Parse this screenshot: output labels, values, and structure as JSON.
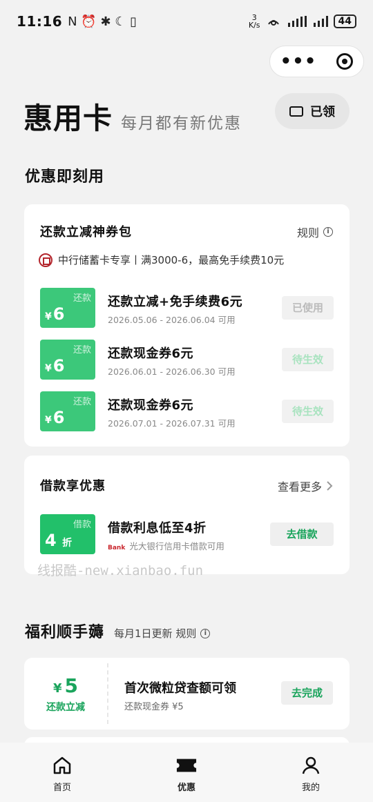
{
  "status": {
    "time": "11:16",
    "left_icons": "N ⏰ ✱ ☾ ▯",
    "net_speed_top": "3",
    "net_speed_unit": "K/s",
    "battery": "44"
  },
  "header": {
    "title": "惠用卡",
    "subtitle": "每月都有新优惠",
    "claimed_label": "已领"
  },
  "section_use": {
    "title": "优惠即刻用"
  },
  "repay_card": {
    "title": "还款立减神券包",
    "rules_label": "规则",
    "bank_note": "中行储蓄卡专享丨满3000-6，最高免手续费10元",
    "coupons": [
      {
        "tag": "还款",
        "currency": "¥",
        "amount": "6",
        "name": "还款立减+免手续费6元",
        "date": "2026.05.06 - 2026.06.04 可用",
        "status": "已使用"
      },
      {
        "tag": "还款",
        "currency": "¥",
        "amount": "6",
        "name": "还款现金券6元",
        "date": "2026.06.01 - 2026.06.30 可用",
        "status": "待生效"
      },
      {
        "tag": "还款",
        "currency": "¥",
        "amount": "6",
        "name": "还款现金券6元",
        "date": "2026.07.01 - 2026.07.31 可用",
        "status": "待生效"
      }
    ]
  },
  "loan_card": {
    "title": "借款享优惠",
    "more_label": "查看更多",
    "coupon": {
      "tag": "借款",
      "amount": "4",
      "unit": "折",
      "name": "借款利息低至4折",
      "bank_mini": "Bank",
      "desc": "光大银行信用卡借款可用",
      "action": "去借款"
    }
  },
  "watermark": "线报酷-new.xianbao.fun",
  "welfare": {
    "title": "福利顺手薅",
    "note": "每月1日更新 规则",
    "item": {
      "currency": "¥",
      "amount": "5",
      "type": "还款立减",
      "name": "首次微粒贷查额可领",
      "desc": "还款现金券 ¥5",
      "action": "去完成"
    }
  },
  "tabbar": {
    "home": "首页",
    "offers": "优惠",
    "mine": "我的"
  },
  "colors": {
    "green": "#3cc87a",
    "dark_green": "#1aa45c",
    "boc_red": "#b3242b"
  }
}
